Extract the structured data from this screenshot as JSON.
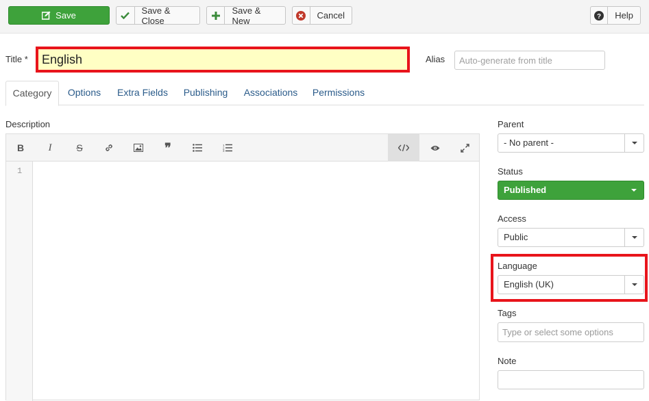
{
  "toolbar": {
    "save": "Save",
    "save_close": "Save & Close",
    "save_new": "Save & New",
    "cancel": "Cancel",
    "help": "Help"
  },
  "form": {
    "title_label": "Title *",
    "title_value": "English",
    "alias_label": "Alias",
    "alias_placeholder": "Auto-generate from title"
  },
  "tabs": [
    "Category",
    "Options",
    "Extra Fields",
    "Publishing",
    "Associations",
    "Permissions"
  ],
  "editor": {
    "label": "Description",
    "line_number": "1"
  },
  "sidebar": {
    "parent_label": "Parent",
    "parent_value": "- No parent -",
    "status_label": "Status",
    "status_value": "Published",
    "access_label": "Access",
    "access_value": "Public",
    "language_label": "Language",
    "language_value": "English (UK)",
    "tags_label": "Tags",
    "tags_placeholder": "Type or select some options",
    "note_label": "Note"
  },
  "colors": {
    "save_green": "#3ea23b",
    "highlight_red": "#e8141b",
    "title_bg": "#ffffc4",
    "tab_link": "#2a5b8a"
  }
}
